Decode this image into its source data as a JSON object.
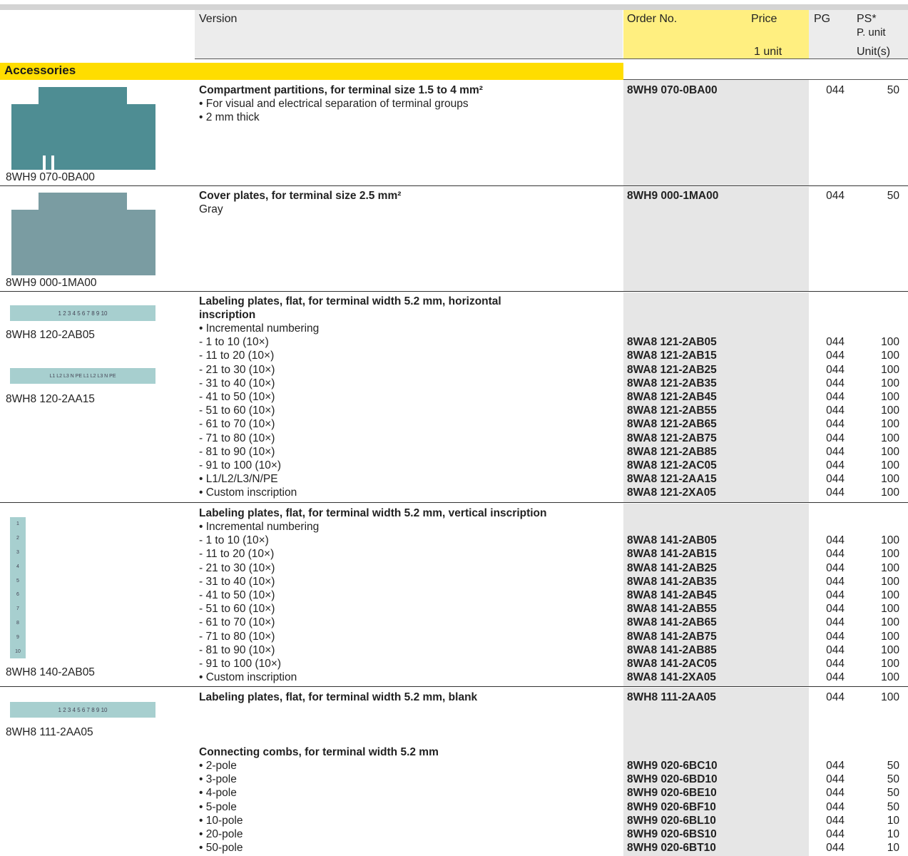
{
  "header": {
    "version": "Version",
    "order_no": "Order No.",
    "price": "Price",
    "price_unit": "1 unit",
    "pg": "PG",
    "ps": "PS*",
    "p_unit": "P. unit",
    "units": "Unit(s)"
  },
  "section_title": "Accessories",
  "colors": {
    "accent_yellow": "#ffdd00",
    "header_yellow": "#ffef80",
    "gray_column": "#e6e6e6"
  },
  "products": [
    {
      "image_label": "8WH9 070-0BA00",
      "title": "Compartment partitions, for terminal size 1.5 to 4 mm²",
      "lines": [
        {
          "text": "• For visual and electrical separation of terminal groups"
        },
        {
          "text": "• 2 mm thick"
        }
      ],
      "order_no": "8WH9 070-0BA00",
      "pg": "044",
      "ps": "50"
    },
    {
      "image_label": "8WH9 000-1MA00",
      "title": "Cover plates, for terminal size 2.5 mm²",
      "lines": [
        {
          "text": "Gray"
        }
      ],
      "order_no": "8WH9 000-1MA00",
      "pg": "044",
      "ps": "50"
    },
    {
      "image_labels": [
        "8WH8 120-2AB05",
        "8WH8 120-2AA15"
      ],
      "strip_text": [
        "1 2 3 4 5 6 7 8 9 10",
        "L1 L2 L3 N PE L1 L2 L3 N PE"
      ],
      "title_lines": [
        "Labeling plates, flat, for terminal width 5.2 mm, horizontal",
        "inscription"
      ],
      "rows": [
        {
          "text": "• Incremental numbering",
          "order": "",
          "pg": "",
          "ps": ""
        },
        {
          "text": "  - 1 to 10 (10×)",
          "order": "8WA8 121-2AB05",
          "pg": "044",
          "ps": "100"
        },
        {
          "text": "  - 11 to 20 (10×)",
          "order": "8WA8 121-2AB15",
          "pg": "044",
          "ps": "100"
        },
        {
          "text": "  - 21 to 30 (10×)",
          "order": "8WA8 121-2AB25",
          "pg": "044",
          "ps": "100"
        },
        {
          "text": "  - 31 to 40 (10×)",
          "order": "8WA8 121-2AB35",
          "pg": "044",
          "ps": "100"
        },
        {
          "text": "  - 41 to 50 (10×)",
          "order": "8WA8 121-2AB45",
          "pg": "044",
          "ps": "100"
        },
        {
          "text": "  - 51 to 60 (10×)",
          "order": "8WA8 121-2AB55",
          "pg": "044",
          "ps": "100"
        },
        {
          "text": "  - 61 to 70 (10×)",
          "order": "8WA8 121-2AB65",
          "pg": "044",
          "ps": "100"
        },
        {
          "text": "  - 71 to 80 (10×)",
          "order": "8WA8 121-2AB75",
          "pg": "044",
          "ps": "100"
        },
        {
          "text": "  - 81 to 90 (10×)",
          "order": "8WA8 121-2AB85",
          "pg": "044",
          "ps": "100"
        },
        {
          "text": "  - 91 to 100 (10×)",
          "order": "8WA8 121-2AC05",
          "pg": "044",
          "ps": "100"
        },
        {
          "text": "• L1/L2/L3/N/PE",
          "order": "8WA8 121-2AA15",
          "pg": "044",
          "ps": "100"
        },
        {
          "text": "• Custom inscription",
          "order": "8WA8 121-2XA05",
          "pg": "044",
          "ps": "100"
        }
      ]
    },
    {
      "image_label": "8WH8 140-2AB05",
      "strip_text": [
        "1",
        "2",
        "3",
        "4",
        "5",
        "6",
        "7",
        "8",
        "9",
        "10"
      ],
      "title": "Labeling plates, flat, for terminal width 5.2 mm, vertical inscription",
      "rows": [
        {
          "text": "• Incremental numbering",
          "order": "",
          "pg": "",
          "ps": ""
        },
        {
          "text": "  - 1 to 10 (10×)",
          "order": "8WA8 141-2AB05",
          "pg": "044",
          "ps": "100"
        },
        {
          "text": "  - 11 to 20 (10×)",
          "order": "8WA8 141-2AB15",
          "pg": "044",
          "ps": "100"
        },
        {
          "text": "  - 21 to 30 (10×)",
          "order": "8WA8 141-2AB25",
          "pg": "044",
          "ps": "100"
        },
        {
          "text": "  - 31 to 40 (10×)",
          "order": "8WA8 141-2AB35",
          "pg": "044",
          "ps": "100"
        },
        {
          "text": "  - 41 to 50 (10×)",
          "order": "8WA8 141-2AB45",
          "pg": "044",
          "ps": "100"
        },
        {
          "text": "  - 51 to 60 (10×)",
          "order": "8WA8 141-2AB55",
          "pg": "044",
          "ps": "100"
        },
        {
          "text": "  - 61 to 70 (10×)",
          "order": "8WA8 141-2AB65",
          "pg": "044",
          "ps": "100"
        },
        {
          "text": "  - 71 to 80 (10×)",
          "order": "8WA8 141-2AB75",
          "pg": "044",
          "ps": "100"
        },
        {
          "text": "  - 81 to 90 (10×)",
          "order": "8WA8 141-2AB85",
          "pg": "044",
          "ps": "100"
        },
        {
          "text": "  - 91 to 100 (10×)",
          "order": "8WA8 141-2AC05",
          "pg": "044",
          "ps": "100"
        },
        {
          "text": "• Custom inscription",
          "order": "8WA8 141-2XA05",
          "pg": "044",
          "ps": "100"
        }
      ]
    },
    {
      "image_label": "8WH8 111-2AA05",
      "strip_text": [
        "1 2 3 4 5 6 7 8 9 10"
      ],
      "title": "Labeling plates, flat, for terminal width 5.2 mm, blank",
      "order_no": "8WH8 111-2AA05",
      "pg": "044",
      "ps": "100"
    },
    {
      "title": "Connecting combs, for terminal width 5.2 mm",
      "rows": [
        {
          "text": "• 2-pole",
          "order": "8WH9 020-6BC10",
          "pg": "044",
          "ps": "50"
        },
        {
          "text": "• 3-pole",
          "order": "8WH9 020-6BD10",
          "pg": "044",
          "ps": "50"
        },
        {
          "text": "• 4-pole",
          "order": "8WH9 020-6BE10",
          "pg": "044",
          "ps": "50"
        },
        {
          "text": "• 5-pole",
          "order": "8WH9 020-6BF10",
          "pg": "044",
          "ps": "50"
        },
        {
          "text": "• 10-pole",
          "order": "8WH9 020-6BL10",
          "pg": "044",
          "ps": "10"
        },
        {
          "text": "• 20-pole",
          "order": "8WH9 020-6BS10",
          "pg": "044",
          "ps": "10"
        },
        {
          "text": "• 50-pole",
          "order": "8WH9 020-6BT10",
          "pg": "044",
          "ps": "10"
        }
      ]
    }
  ]
}
